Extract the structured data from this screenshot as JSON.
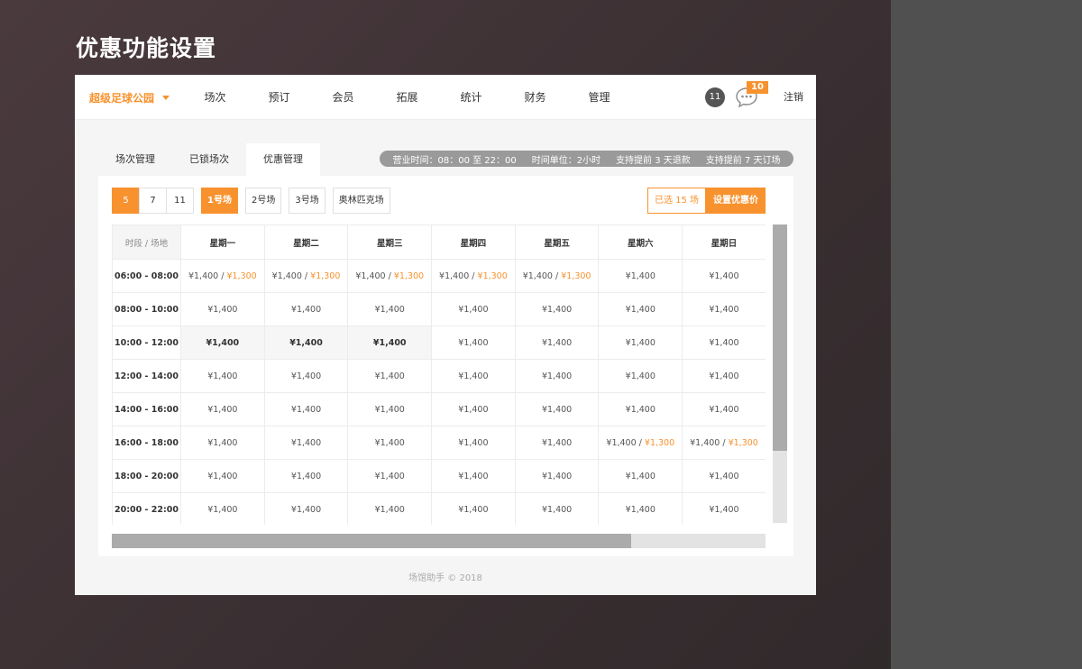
{
  "page_heading": "优惠功能设置",
  "header": {
    "brand": "超级足球公园",
    "nav": [
      "场次",
      "预订",
      "会员",
      "拓展",
      "统计",
      "财务",
      "管理"
    ],
    "avatar_text": "11",
    "message_badge": "10",
    "logout": "注销"
  },
  "tabs": [
    "场次管理",
    "已锁场次",
    "优惠管理"
  ],
  "info": {
    "hours": "营业时间：08：00 至 22：00",
    "unit": "时间单位：2小时",
    "refund": "支持提前 3 天退款",
    "booking": "支持提前 7 天订场"
  },
  "filters": {
    "days": [
      "5",
      "7",
      "11"
    ],
    "courts": [
      "1号场",
      "2号场",
      "3号场",
      "奥林匹克场"
    ]
  },
  "selection": {
    "count_label": "已选 15 场",
    "set_price": "设置优惠价"
  },
  "schedule": {
    "corner": "时段 / 场地",
    "days": [
      "星期一",
      "星期二",
      "星期三",
      "星期四",
      "星期五",
      "星期六",
      "星期日"
    ],
    "rows": [
      {
        "slot": "06:00 - 08:00",
        "cells": [
          {
            "price": "¥1,400",
            "discount": "¥1,300"
          },
          {
            "price": "¥1,400",
            "discount": "¥1,300"
          },
          {
            "price": "¥1,400",
            "discount": "¥1,300"
          },
          {
            "price": "¥1,400",
            "discount": "¥1,300"
          },
          {
            "price": "¥1,400",
            "discount": "¥1,300"
          },
          {
            "price": "¥1,400"
          },
          {
            "price": "¥1,400"
          }
        ]
      },
      {
        "slot": "08:00 - 10:00",
        "cells": [
          {
            "price": "¥1,400"
          },
          {
            "price": "¥1,400"
          },
          {
            "price": "¥1,400"
          },
          {
            "price": "¥1,400"
          },
          {
            "price": "¥1,400"
          },
          {
            "price": "¥1,400"
          },
          {
            "price": "¥1,400"
          }
        ]
      },
      {
        "slot": "10:00 - 12:00",
        "cells": [
          {
            "price": "¥1,400",
            "selected": true
          },
          {
            "price": "¥1,400",
            "selected": true
          },
          {
            "price": "¥1,400",
            "selected": true
          },
          {
            "price": "¥1,400"
          },
          {
            "price": "¥1,400"
          },
          {
            "price": "¥1,400"
          },
          {
            "price": "¥1,400"
          }
        ]
      },
      {
        "slot": "12:00 - 14:00",
        "cells": [
          {
            "price": "¥1,400"
          },
          {
            "price": "¥1,400"
          },
          {
            "price": "¥1,400"
          },
          {
            "price": "¥1,400"
          },
          {
            "price": "¥1,400"
          },
          {
            "price": "¥1,400"
          },
          {
            "price": "¥1,400"
          }
        ]
      },
      {
        "slot": "14:00 - 16:00",
        "cells": [
          {
            "price": "¥1,400"
          },
          {
            "price": "¥1,400"
          },
          {
            "price": "¥1,400"
          },
          {
            "price": "¥1,400"
          },
          {
            "price": "¥1,400"
          },
          {
            "price": "¥1,400"
          },
          {
            "price": "¥1,400"
          }
        ]
      },
      {
        "slot": "16:00 - 18:00",
        "cells": [
          {
            "price": "¥1,400"
          },
          {
            "price": "¥1,400"
          },
          {
            "price": "¥1,400"
          },
          {
            "price": "¥1,400"
          },
          {
            "price": "¥1,400"
          },
          {
            "price": "¥1,400",
            "discount": "¥1,300"
          },
          {
            "price": "¥1,400",
            "discount": "¥1,300"
          }
        ]
      },
      {
        "slot": "18:00 - 20:00",
        "cells": [
          {
            "price": "¥1,400"
          },
          {
            "price": "¥1,400"
          },
          {
            "price": "¥1,400"
          },
          {
            "price": "¥1,400"
          },
          {
            "price": "¥1,400"
          },
          {
            "price": "¥1,400"
          },
          {
            "price": "¥1,400"
          }
        ]
      },
      {
        "slot": "20:00 - 22:00",
        "cells": [
          {
            "price": "¥1,400"
          },
          {
            "price": "¥1,400"
          },
          {
            "price": "¥1,400"
          },
          {
            "price": "¥1,400"
          },
          {
            "price": "¥1,400"
          },
          {
            "price": "¥1,400"
          },
          {
            "price": "¥1,400"
          }
        ]
      }
    ]
  },
  "footer": "场馆助手 © 2018",
  "colors": {
    "accent": "#f7922e"
  }
}
